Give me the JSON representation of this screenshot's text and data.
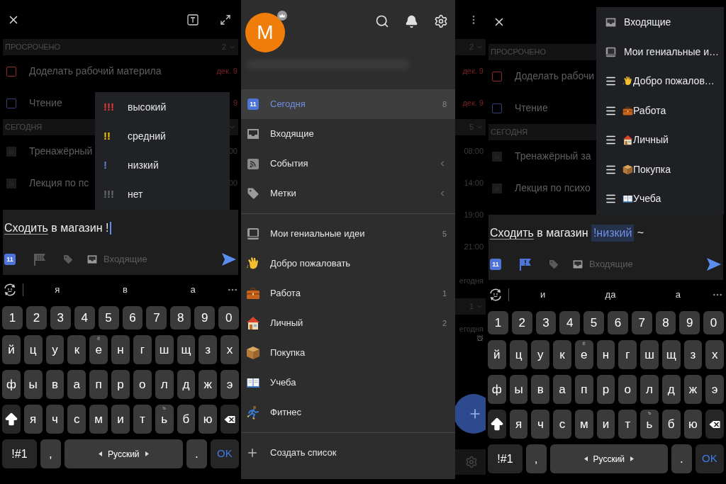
{
  "left_screen": {
    "sections": [
      {
        "label": "ПРОСРОЧЕНО",
        "count": "2",
        "chevron": true,
        "tasks": [
          {
            "kind": "task",
            "title": "Доделать рабочий материла",
            "date": "дек. 9",
            "color": "#8e2a2a"
          },
          {
            "kind": "task",
            "title": "Чтение",
            "date": "9",
            "color": "#33407a"
          }
        ]
      },
      {
        "label": "СЕГОДНЯ",
        "chevron": true,
        "tasks": [
          {
            "kind": "event",
            "title": "Тренажёрный",
            "time": "00"
          },
          {
            "kind": "event",
            "title": "Лекция по пс",
            "time": "00"
          }
        ]
      }
    ],
    "priority_menu": [
      {
        "mark": "!!!",
        "label": "высокий",
        "color": "#e53935"
      },
      {
        "mark": "!!",
        "label": "средний",
        "color": "#f2c200"
      },
      {
        "mark": "!",
        "label": "низкий",
        "color": "#5b7fd6"
      },
      {
        "mark": "!!!",
        "label": "нет",
        "color": "#6a6a6a"
      }
    ],
    "input": {
      "segments": [
        {
          "text": "Сходить",
          "kind": "date"
        },
        {
          "text": "в магазин !",
          "kind": "plain"
        }
      ],
      "caret": true
    },
    "toolbar": {
      "date": "11",
      "flag_set": false,
      "list": "Входящие"
    },
    "keyboard": {
      "suggestions": [
        "я",
        "в",
        "а"
      ],
      "rows": [
        {
          "keys": [
            "1",
            "2",
            "3",
            "4",
            "5",
            "6",
            "7",
            "8",
            "9",
            "0"
          ]
        },
        {
          "keys": [
            "й",
            "ц",
            "у",
            "к",
            {
              "kind": "hint",
              "label": "е",
              "hint": "ё"
            },
            "н",
            "г",
            "ш",
            "щ",
            "з",
            "х"
          ]
        },
        {
          "keys": [
            "ф",
            "ы",
            "в",
            "а",
            "п",
            "р",
            "о",
            "л",
            "д",
            "ж",
            "э"
          ]
        },
        {
          "keys": [
            {
              "kind": "shift"
            },
            "я",
            "ч",
            "с",
            "м",
            "и",
            "т",
            {
              "kind": "hint",
              "label": "ь",
              "hint": "ъ"
            },
            "б",
            "ю",
            {
              "kind": "backspace"
            }
          ]
        },
        {
          "keys": [
            {
              "kind": "symbols",
              "label": "!#1"
            },
            ",",
            {
              "kind": "space",
              "label": "Русский"
            },
            ".",
            {
              "kind": "enter",
              "label": "OK"
            }
          ]
        }
      ]
    }
  },
  "drawer_screen": {
    "avatar": "M",
    "items": [
      {
        "kind": "calendar",
        "date": "11",
        "label": "Сегодня",
        "count": "8",
        "selected": true,
        "expandable": false
      },
      {
        "kind": "inbox",
        "label": "Входящие",
        "selected": false,
        "expandable": false
      },
      {
        "kind": "events",
        "label": "События",
        "selected": false,
        "expandable": true
      },
      {
        "kind": "tag",
        "label": "Метки",
        "selected": false,
        "expandable": true
      }
    ],
    "lists": [
      {
        "kind": "notebook",
        "label": "Мои гениальные идеи",
        "count": "5",
        "selected": false
      },
      {
        "kind": "hand",
        "label": "Добро пожаловать",
        "selected": false
      },
      {
        "kind": "briefcase",
        "label": "Работа",
        "count": "1",
        "selected": false
      },
      {
        "kind": "house",
        "label": "Личный",
        "count": "2",
        "selected": false
      },
      {
        "kind": "box",
        "label": "Покупка",
        "selected": false
      },
      {
        "kind": "book",
        "label": "Учеба",
        "selected": false
      },
      {
        "kind": "runner",
        "label": "Фитнес",
        "selected": false
      }
    ],
    "create_list": "Создать список",
    "background_strip": [
      {
        "kind": "menu"
      },
      {
        "kind": "count",
        "text": "2"
      },
      {
        "kind": "date",
        "text": "дек. 9"
      },
      {
        "kind": "date",
        "text": "дек. 9"
      },
      {
        "kind": "count",
        "text": "5"
      },
      {
        "kind": "time",
        "text": "08:00"
      },
      {
        "kind": "time",
        "text": "14:00"
      },
      {
        "kind": "time",
        "text": "19:00"
      },
      {
        "kind": "time",
        "text": "21:00"
      },
      {
        "kind": "note",
        "text": "егодня"
      },
      {
        "kind": "count",
        "text": "1"
      },
      {
        "kind": "note",
        "text": "егодня",
        "reminder": true
      },
      {
        "kind": "fab"
      },
      {
        "kind": "gear"
      }
    ]
  },
  "right_screen": {
    "sections": [
      {
        "label": "ПРОСРОЧЕНО",
        "tasks": [
          {
            "kind": "task",
            "title": "Доделать рабочи",
            "color": "#8e2a2a"
          },
          {
            "kind": "task",
            "title": "Чтение",
            "color": "#33407a"
          }
        ]
      },
      {
        "label": "СЕГОДНЯ",
        "tasks": [
          {
            "kind": "event",
            "title": "Тренажёрный за"
          },
          {
            "kind": "event",
            "title": "Лекция по психо"
          }
        ]
      }
    ],
    "list_menu": [
      {
        "kind": "inbox",
        "label": "Входящие"
      },
      {
        "kind": "notebook",
        "label": "Мои гениальные и…"
      },
      {
        "kind": "hand",
        "label": "Добро пожалов…"
      },
      {
        "kind": "briefcase",
        "label": "Работа"
      },
      {
        "kind": "house",
        "label": "Личный"
      },
      {
        "kind": "box",
        "label": "Покупка"
      },
      {
        "kind": "book",
        "label": "Учеба"
      }
    ],
    "input": {
      "segments": [
        {
          "text": "Сходить",
          "kind": "date"
        },
        {
          "text": "в магазин",
          "kind": "plain"
        },
        {
          "text": "!низкий",
          "kind": "priority"
        },
        {
          "text": "~",
          "kind": "plain"
        }
      ],
      "caret": false
    },
    "toolbar": {
      "date": "11",
      "flag_set": true,
      "list": "Входящие"
    },
    "keyboard": {
      "suggestions": [
        "и",
        "да",
        "а"
      ],
      "rows": [
        {
          "keys": [
            "1",
            "2",
            "3",
            "4",
            "5",
            "6",
            "7",
            "8",
            "9",
            "0"
          ]
        },
        {
          "keys": [
            "й",
            "ц",
            "у",
            "к",
            {
              "kind": "hint",
              "label": "е",
              "hint": "ё"
            },
            "н",
            "г",
            "ш",
            "щ",
            "з",
            "х"
          ]
        },
        {
          "keys": [
            "ф",
            "ы",
            "в",
            "а",
            "п",
            "р",
            "о",
            "л",
            "д",
            "ж",
            "э"
          ]
        },
        {
          "keys": [
            {
              "kind": "shift"
            },
            "я",
            "ч",
            "с",
            "м",
            "и",
            "т",
            {
              "kind": "hint",
              "label": "ь",
              "hint": "ъ"
            },
            "б",
            "ю",
            {
              "kind": "backspace"
            }
          ]
        },
        {
          "keys": [
            {
              "kind": "symbols",
              "label": "!#1"
            },
            ",",
            {
              "kind": "space",
              "label": "Русский"
            },
            ".",
            {
              "kind": "enter",
              "label": "OK"
            }
          ]
        }
      ]
    }
  }
}
